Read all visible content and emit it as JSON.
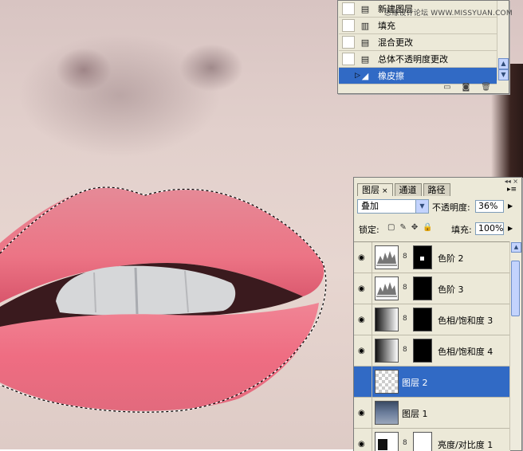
{
  "history_panel": {
    "watermark": "思缘设计论坛 WWW.MISSYUAN.COM",
    "items": [
      {
        "label": "新建图层",
        "icon": "document-icon",
        "selected": false
      },
      {
        "label": "填充",
        "icon": "fill-icon",
        "selected": false
      },
      {
        "label": "混合更改",
        "icon": "document-icon",
        "selected": false
      },
      {
        "label": "总体不透明度更改",
        "icon": "document-icon",
        "selected": false
      },
      {
        "label": "橡皮擦",
        "icon": "eraser-icon",
        "selected": true
      }
    ]
  },
  "layers_panel": {
    "tabs": [
      {
        "label": "图层",
        "active": true
      },
      {
        "label": "通道",
        "active": false
      },
      {
        "label": "路径",
        "active": false
      }
    ],
    "tab_close": "×",
    "blend_mode": "叠加",
    "opacity_label": "不透明度:",
    "opacity_value": "36%",
    "lock_label": "锁定:",
    "fill_label": "填充:",
    "fill_value": "100%",
    "layers": [
      {
        "name": "色阶 2",
        "thumb": "levels",
        "mask": "dot",
        "selected": false
      },
      {
        "name": "色阶 3",
        "thumb": "levels",
        "mask": "black",
        "selected": false
      },
      {
        "name": "色相/饱和度 3",
        "thumb": "gradient",
        "mask": "black",
        "selected": false
      },
      {
        "name": "色相/饱和度 4",
        "thumb": "gradient",
        "mask": "black",
        "selected": false
      },
      {
        "name": "图层 2",
        "thumb": "transparent",
        "mask": null,
        "selected": true
      },
      {
        "name": "图层 1",
        "thumb": "photo",
        "mask": null,
        "selected": false
      },
      {
        "name": "亮度/对比度 1",
        "thumb": "brightness",
        "mask": "white",
        "selected": false
      }
    ]
  }
}
